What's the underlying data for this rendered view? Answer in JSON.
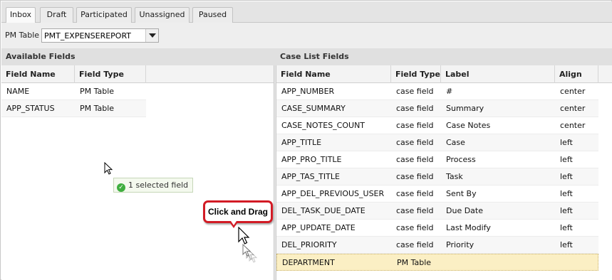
{
  "tabs": [
    {
      "label": "Inbox",
      "active": true
    },
    {
      "label": "Draft",
      "active": false
    },
    {
      "label": "Participated",
      "active": false
    },
    {
      "label": "Unassigned",
      "active": false
    },
    {
      "label": "Paused",
      "active": false
    }
  ],
  "pm_table": {
    "label": "PM Table",
    "selected": "PMT_EXPENSEREPORT"
  },
  "available_fields": {
    "title": "Available Fields",
    "columns": [
      "Field Name",
      "Field Type"
    ],
    "rows": [
      {
        "field_name": "NAME",
        "field_type": "PM Table"
      },
      {
        "field_name": "APP_STATUS",
        "field_type": "PM Table"
      }
    ]
  },
  "case_list_fields": {
    "title": "Case List Fields",
    "columns": [
      "Field Name",
      "Field Type",
      "Label",
      "Align"
    ],
    "rows": [
      {
        "field_name": "APP_NUMBER",
        "field_type": "case field",
        "label": "#",
        "align": "center"
      },
      {
        "field_name": "CASE_SUMMARY",
        "field_type": "case field",
        "label": "Summary",
        "align": "center"
      },
      {
        "field_name": "CASE_NOTES_COUNT",
        "field_type": "case field",
        "label": "Case Notes",
        "align": "center"
      },
      {
        "field_name": "APP_TITLE",
        "field_type": "case field",
        "label": "Case",
        "align": "left"
      },
      {
        "field_name": "APP_PRO_TITLE",
        "field_type": "case field",
        "label": "Process",
        "align": "left"
      },
      {
        "field_name": "APP_TAS_TITLE",
        "field_type": "case field",
        "label": "Task",
        "align": "left"
      },
      {
        "field_name": "APP_DEL_PREVIOUS_USER",
        "field_type": "case field",
        "label": "Sent By",
        "align": "left"
      },
      {
        "field_name": "DEL_TASK_DUE_DATE",
        "field_type": "case field",
        "label": "Due Date",
        "align": "left"
      },
      {
        "field_name": "APP_UPDATE_DATE",
        "field_type": "case field",
        "label": "Last Modify",
        "align": "left"
      },
      {
        "field_name": "DEL_PRIORITY",
        "field_type": "case field",
        "label": "Priority",
        "align": "left"
      },
      {
        "field_name": "DEPARTMENT",
        "field_type": "PM Table",
        "label": "",
        "align": ""
      }
    ]
  },
  "drag_tooltip": {
    "icon": "check-circle-icon",
    "text": "1 selected field"
  },
  "callout": {
    "text": "Click and Drag"
  },
  "colors": {
    "highlight_row": "#fbefc4",
    "callout_border": "#d21b25",
    "check_green": "#3fae3f"
  }
}
